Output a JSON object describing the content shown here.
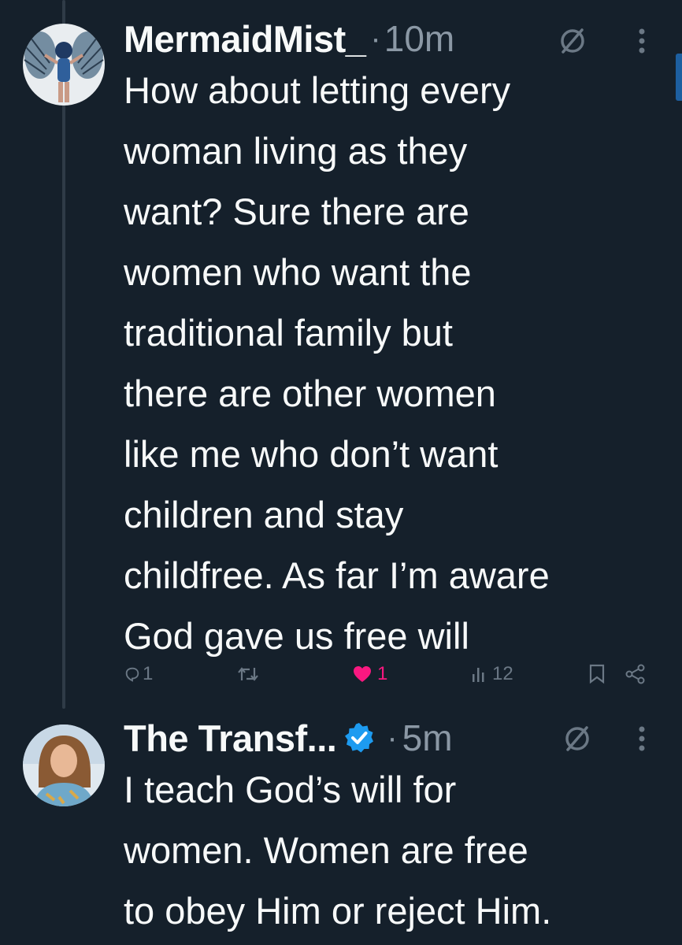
{
  "tweets": [
    {
      "display_name": "MermaidMist_",
      "separator": "·",
      "time": "10m",
      "verified": false,
      "lines": [
        "How about letting every",
        "woman living as they",
        "want? Sure there are",
        "women who want the",
        "traditional family but",
        "there are other women",
        "like me who don’t want",
        "children and stay",
        "childfree. As far I’m aware",
        "God gave us free will"
      ],
      "actions": {
        "replies": "1",
        "retweets": "",
        "likes": "1",
        "views": "12"
      }
    },
    {
      "display_name": "The Transf...",
      "separator": "·",
      "time": "5m",
      "verified": true,
      "lines": [
        "I teach God’s will for",
        "women. Women are free",
        "to obey Him or reject Him."
      ]
    }
  ],
  "icons": {
    "reply": "reply-icon",
    "retweet": "retweet-icon",
    "like": "heart-icon",
    "views": "views-icon",
    "bookmark": "bookmark-icon",
    "share": "share-icon",
    "grok": "grok-icon",
    "more": "more-icon",
    "verified": "verified-badge-icon"
  },
  "colors": {
    "background": "#15202b",
    "text": "#f7f9f9",
    "muted": "#8b98a5",
    "like": "#f91880",
    "verified": "#1d9bf0"
  }
}
